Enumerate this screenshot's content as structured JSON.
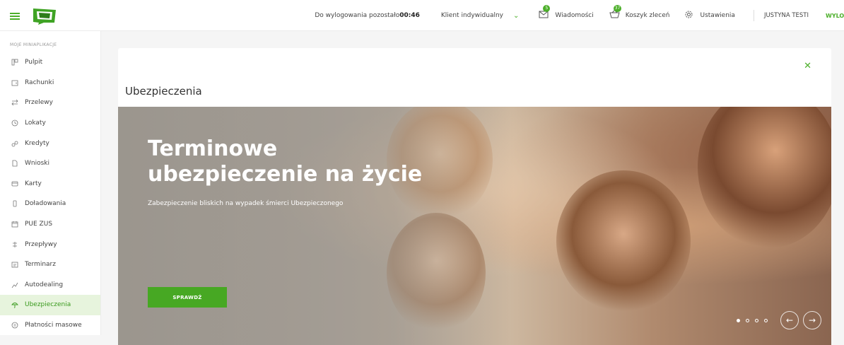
{
  "header": {
    "logout_timer_text": "Do wylogowania pozostało ",
    "logout_timer_value": "00:46",
    "client_type": "Klient indywidualny",
    "messages_label": "Wiadomości",
    "messages_count": "5",
    "cart_label": "Koszyk zleceń",
    "cart_count": "37",
    "settings_label": "Ustawienia",
    "user_name": "JUSTYNA TESTI",
    "logout_label": "WYLOG",
    "accent_color": "#4caf2a"
  },
  "sidebar": {
    "title": "MOJE MINIAPLIKACJE",
    "items": [
      {
        "label": "Pulpit",
        "icon": "dashboard-icon"
      },
      {
        "label": "Rachunki",
        "icon": "wallet-icon"
      },
      {
        "label": "Przelewy",
        "icon": "transfer-icon"
      },
      {
        "label": "Lokaty",
        "icon": "clock-icon"
      },
      {
        "label": "Kredyty",
        "icon": "coins-icon"
      },
      {
        "label": "Wnioski",
        "icon": "document-icon"
      },
      {
        "label": "Karty",
        "icon": "card-icon"
      },
      {
        "label": "Doładowania",
        "icon": "phone-icon"
      },
      {
        "label": "PUE ZUS",
        "icon": "calendar-icon"
      },
      {
        "label": "Przepływy",
        "icon": "flow-icon"
      },
      {
        "label": "Terminarz",
        "icon": "planner-icon"
      },
      {
        "label": "Autodealing",
        "icon": "chart-icon"
      },
      {
        "label": "Ubezpieczenia",
        "icon": "umbrella-icon",
        "active": true
      },
      {
        "label": "Płatności masowe",
        "icon": "bulk-payment-icon"
      }
    ]
  },
  "main": {
    "title": "Ubezpieczenia",
    "hero": {
      "title": "Terminowe ubezpieczenie na życie",
      "subtitle": "Zabezpieczenie bliskich na wypadek śmierci Ubezpieczonego",
      "cta_label": "SPRAWDŹ",
      "slides_count": 4,
      "active_slide": 1
    }
  }
}
